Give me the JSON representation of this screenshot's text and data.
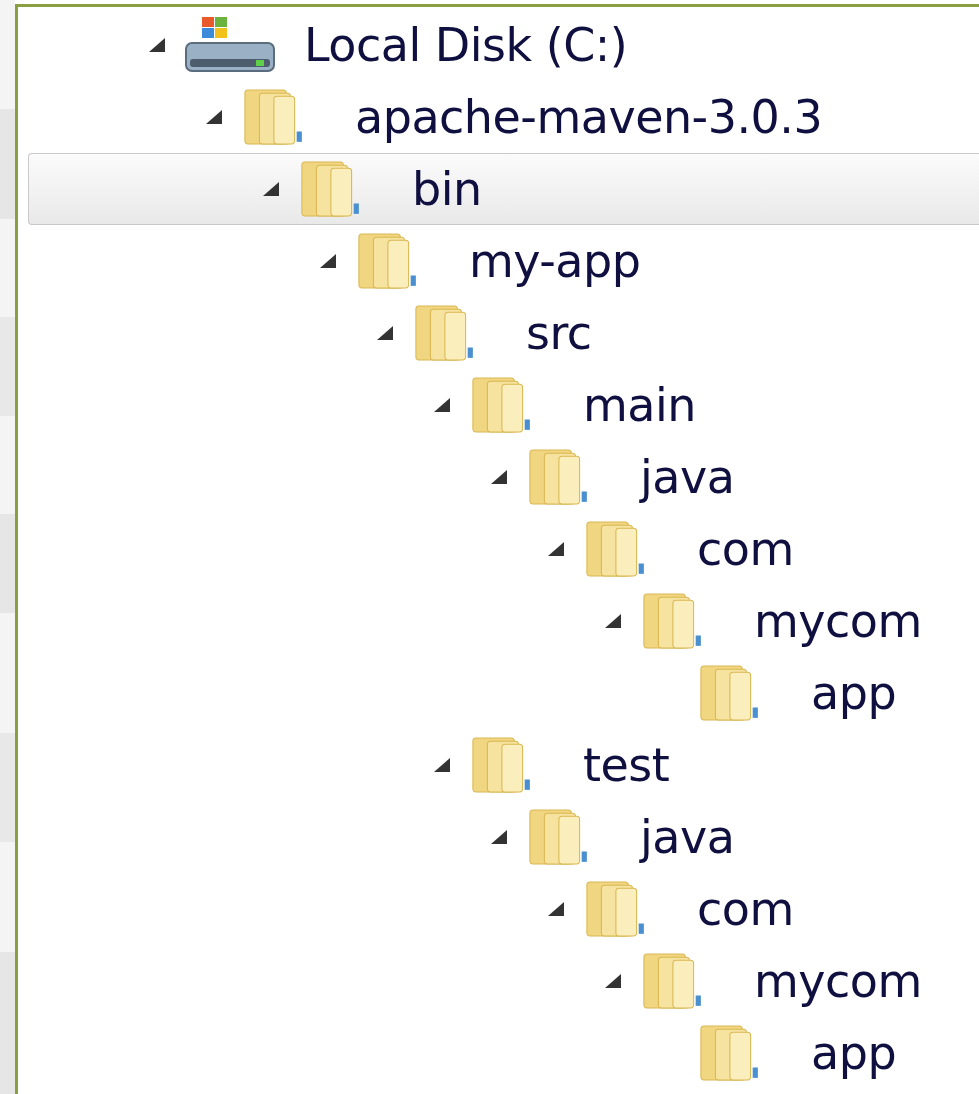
{
  "tree": [
    {
      "label": "Local Disk (C:)",
      "kind": "drive",
      "expanded": true,
      "selected": false,
      "children": [
        {
          "label": "apache-maven-3.0.3",
          "kind": "folder",
          "expanded": true,
          "selected": false,
          "children": [
            {
              "label": "bin",
              "kind": "folder",
              "expanded": true,
              "selected": true,
              "children": [
                {
                  "label": "my-app",
                  "kind": "folder",
                  "expanded": true,
                  "selected": false,
                  "children": [
                    {
                      "label": "src",
                      "kind": "folder",
                      "expanded": true,
                      "selected": false,
                      "children": [
                        {
                          "label": "main",
                          "kind": "folder",
                          "expanded": true,
                          "selected": false,
                          "children": [
                            {
                              "label": "java",
                              "kind": "folder",
                              "expanded": true,
                              "selected": false,
                              "children": [
                                {
                                  "label": "com",
                                  "kind": "folder",
                                  "expanded": true,
                                  "selected": false,
                                  "children": [
                                    {
                                      "label": "mycom",
                                      "kind": "folder",
                                      "expanded": true,
                                      "selected": false,
                                      "children": [
                                        {
                                          "label": "app",
                                          "kind": "folder",
                                          "selected": false
                                        }
                                      ]
                                    }
                                  ]
                                }
                              ]
                            }
                          ]
                        },
                        {
                          "label": "test",
                          "kind": "folder",
                          "expanded": true,
                          "selected": false,
                          "children": [
                            {
                              "label": "java",
                              "kind": "folder",
                              "expanded": true,
                              "selected": false,
                              "children": [
                                {
                                  "label": "com",
                                  "kind": "folder",
                                  "expanded": true,
                                  "selected": false,
                                  "children": [
                                    {
                                      "label": "mycom",
                                      "kind": "folder",
                                      "expanded": true,
                                      "selected": false,
                                      "children": [
                                        {
                                          "label": "app",
                                          "kind": "folder",
                                          "selected": false
                                        }
                                      ]
                                    }
                                  ]
                                }
                              ]
                            }
                          ]
                        }
                      ]
                    }
                  ]
                }
              ]
            }
          ]
        }
      ]
    }
  ]
}
